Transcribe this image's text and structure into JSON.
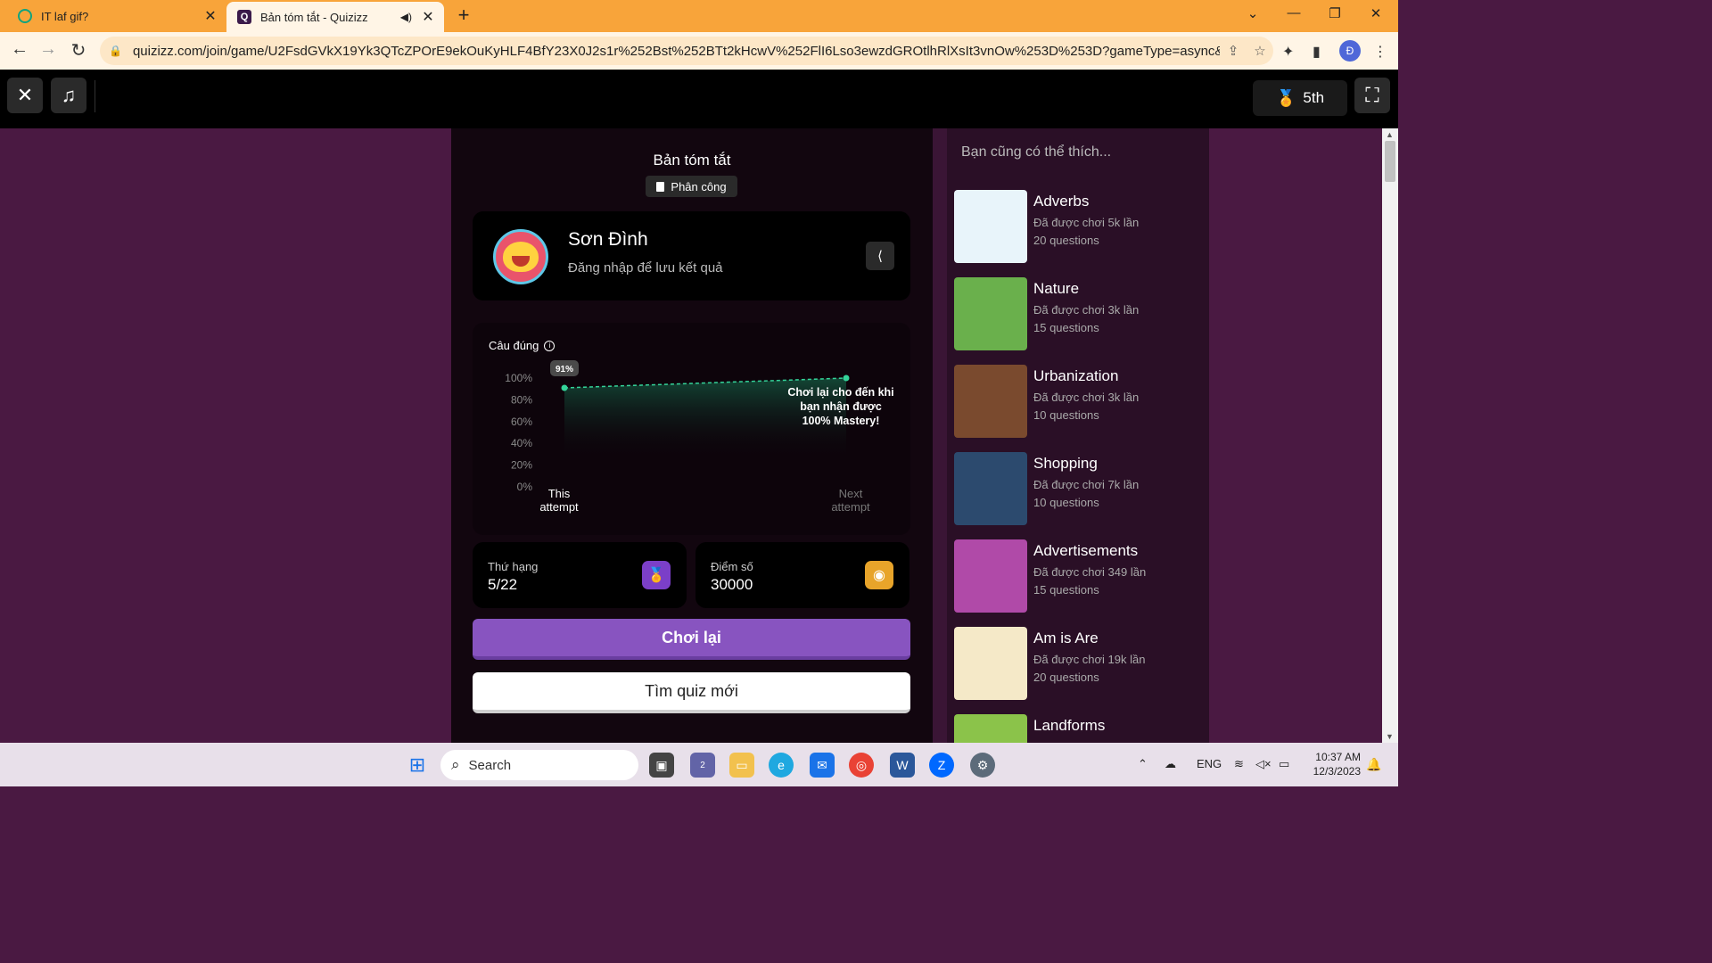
{
  "browser": {
    "tabs": [
      {
        "title": "IT laf gif?",
        "close": "✕"
      },
      {
        "title": "Bản tóm tắt - Quizizz",
        "close": "✕"
      }
    ],
    "new_tab": "+",
    "url": "quizizz.com/join/game/U2FsdGVkX19Yk3QTcZPOrE9ekOuKyHLF4BfY23X0J2s1r%252Bst%252BTt2kHcwV%252FlI6Lso3ewzdGROtlhRlXsIt3vnOw%253D%253D?gameType=async&page=summa...",
    "profile_initial": "Đ"
  },
  "quiz_header": {
    "rank_badge": "5th"
  },
  "summary": {
    "title": "Bản tóm tắt",
    "assign_label": "Phân công",
    "player_name": "Sơn Đình",
    "login_prompt": "Đăng nhập để lưu kết quả",
    "accuracy_label": "Câu đúng",
    "rank_label": "Thứ hạng",
    "rank_value": "5/22",
    "score_label": "Điểm số",
    "score_value": "30000",
    "play_again": "Chơi lại",
    "find_new": "Tìm quiz mới"
  },
  "chart_data": {
    "type": "line",
    "title": "Câu đúng",
    "x": [
      "This attempt",
      "Next attempt"
    ],
    "x_labels": [
      [
        "This",
        "attempt"
      ],
      [
        "Next",
        "attempt"
      ]
    ],
    "series": [
      {
        "values": [
          91,
          100
        ]
      }
    ],
    "ylim": [
      0,
      100
    ],
    "yticks": [
      "100%",
      "80%",
      "60%",
      "40%",
      "20%",
      "0%"
    ],
    "point_label": "91%",
    "annotation": [
      "Chơi lại cho đến khi",
      "bạn nhận được",
      "100% Mastery!"
    ],
    "colors": {
      "line": "#34d399",
      "fill": "#0f3b2e"
    }
  },
  "sidebar": {
    "heading": "Bạn cũng có thể thích...",
    "items": [
      {
        "name": "Adverbs",
        "plays": "Đã được chơi 5k lần",
        "questions": "20 questions",
        "thumb": "#e8f4fa"
      },
      {
        "name": "Nature",
        "plays": "Đã được chơi 3k lần",
        "questions": "15 questions",
        "thumb": "#6ab04c"
      },
      {
        "name": "Urbanization",
        "plays": "Đã được chơi 3k lần",
        "questions": "10 questions",
        "thumb": "#7a4a2e"
      },
      {
        "name": "Shopping",
        "plays": "Đã được chơi 7k lần",
        "questions": "10 questions",
        "thumb": "#2c4a6e"
      },
      {
        "name": "Advertisements",
        "plays": "Đã được chơi 349 lần",
        "questions": "15 questions",
        "thumb": "#b04aa8"
      },
      {
        "name": "Am is Are",
        "plays": "Đã được chơi 19k lần",
        "questions": "20 questions",
        "thumb": "#f5e9c8"
      },
      {
        "name": "Landforms",
        "plays": "",
        "questions": "",
        "thumb": "#8bc34a"
      }
    ]
  },
  "taskbar": {
    "search_placeholder": "Search",
    "chat_badge": "2",
    "language": "ENG",
    "time": "10:37 AM",
    "date": "12/3/2023"
  }
}
